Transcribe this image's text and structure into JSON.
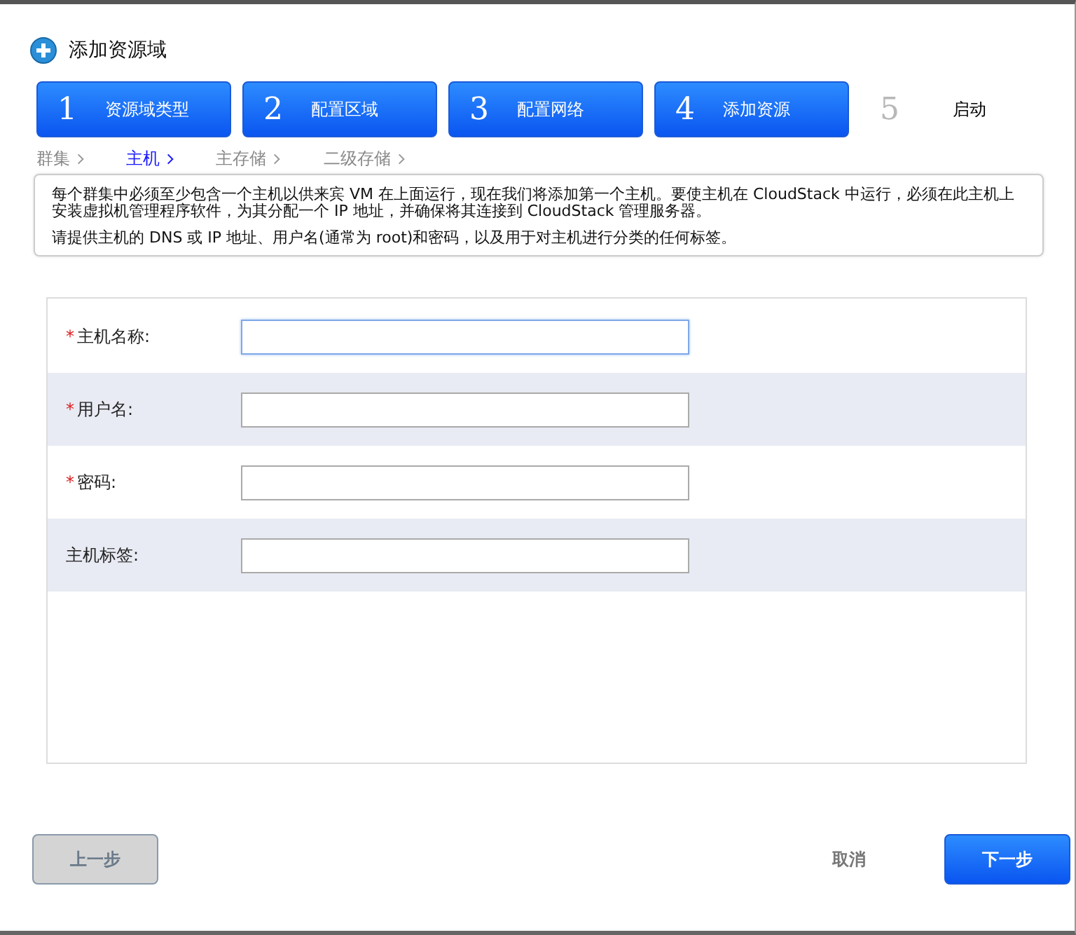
{
  "dialog": {
    "title": "添加资源域"
  },
  "steps": [
    {
      "number": "1",
      "label": "资源域类型",
      "active": true
    },
    {
      "number": "2",
      "label": "配置区域",
      "active": true
    },
    {
      "number": "3",
      "label": "配置网络",
      "active": true
    },
    {
      "number": "4",
      "label": "添加资源",
      "active": true
    },
    {
      "number": "5",
      "label": "启动",
      "active": false
    }
  ],
  "substeps": [
    {
      "label": "群集",
      "selected": false
    },
    {
      "label": "主机",
      "selected": true
    },
    {
      "label": "主存储",
      "selected": false
    },
    {
      "label": "二级存储",
      "selected": false
    }
  ],
  "info": [
    "每个群集中必须至少包含一个主机以供来宾 VM 在上面运行，现在我们将添加第一个主机。要使主机在 CloudStack 中运行，必须在此主机上安装虚拟机管理程序软件，为其分配一个 IP 地址，并确保将其连接到 CloudStack 管理服务器。",
    "请提供主机的 DNS 或 IP 地址、用户名(通常为 root)和密码，以及用于对主机进行分类的任何标签。"
  ],
  "fields": [
    {
      "label": "主机名称:",
      "required_mark": "*",
      "focused": true
    },
    {
      "label": "用户名:",
      "required_mark": "*",
      "focused": false
    },
    {
      "label": "密码:",
      "required_mark": "*",
      "focused": false
    },
    {
      "label": "主机标签:",
      "focused": false
    }
  ],
  "buttons": {
    "back": "上一步",
    "cancel": "取消",
    "next": "下一步"
  }
}
